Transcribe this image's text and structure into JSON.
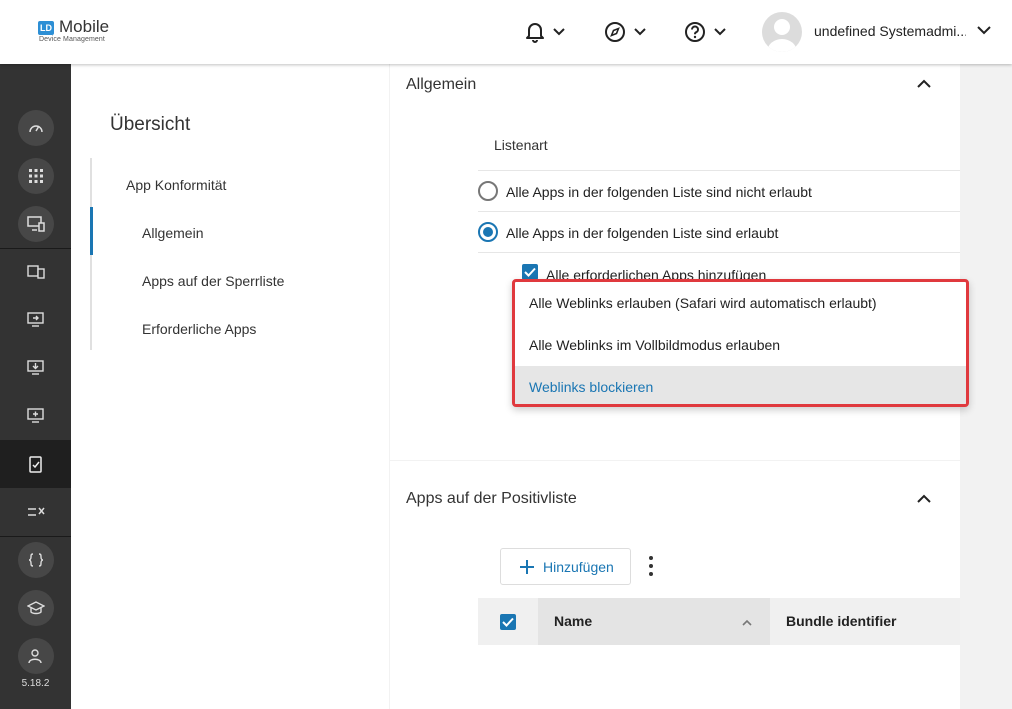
{
  "app": {
    "logo_badge": "LD",
    "logo_title": "Mobile",
    "logo_subtitle": "Device Management",
    "version": "5.18.2"
  },
  "header": {
    "user_name": "undefined Systemadmi..."
  },
  "sidebar_icons": [
    "dashboard-icon",
    "apps-grid-icon",
    "device-monitor-icon",
    "devices-icon",
    "screen-forward-icon",
    "download-device-icon",
    "monitor-plus-icon",
    "compliance-icon",
    "rules-icon",
    "braces-icon",
    "school-icon",
    "user-settings-icon"
  ],
  "subnav": {
    "title": "Übersicht",
    "items": [
      "App Konformität",
      "Allgemein",
      "Apps auf der Sperrliste",
      "Erforderliche Apps"
    ]
  },
  "general": {
    "title": "Allgemein",
    "list_type_label": "Listenart",
    "options": [
      "Alle Apps in der folgenden Liste sind nicht erlaubt",
      "Alle Apps in der folgenden Liste sind erlaubt"
    ],
    "selected_option": 1,
    "checkbox_label": "Alle erforderlichen Apps hinzufügen"
  },
  "dropdown": {
    "items": [
      "Alle Weblinks erlauben (Safari wird automatisch erlaubt)",
      "Alle Weblinks im Vollbildmodus erlauben",
      "Weblinks blockieren"
    ],
    "selected": 2
  },
  "allowlist": {
    "title": "Apps auf der Positivliste",
    "add_label": "Hinzufügen",
    "columns": [
      "Name",
      "Bundle identifier"
    ]
  },
  "colors": {
    "accent": "#1a76b3",
    "highlight_border": "#e0393e",
    "sidebar": "#333333"
  }
}
